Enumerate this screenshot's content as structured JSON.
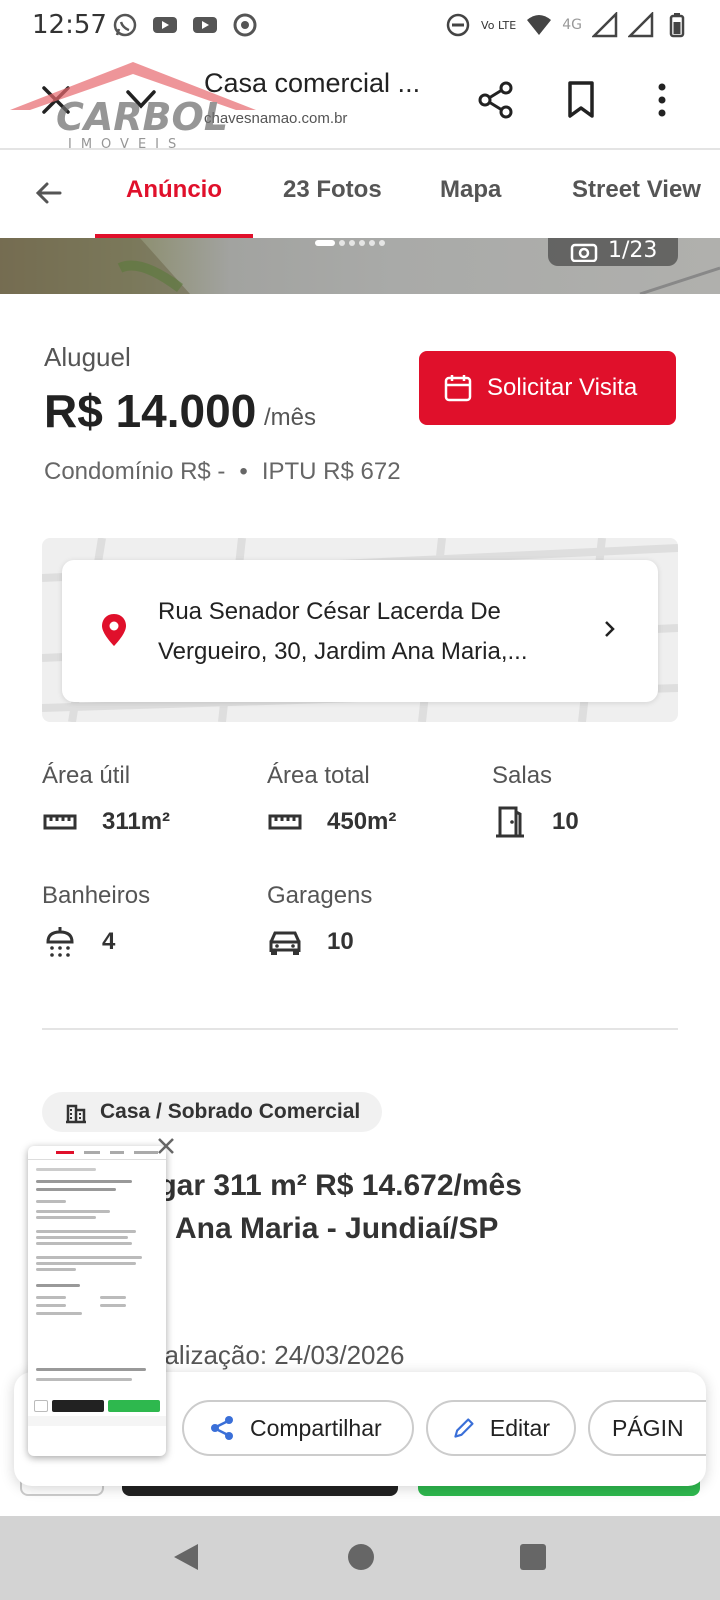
{
  "status_bar": {
    "time": "12:57",
    "network": "4G",
    "volte": "Vo LTE",
    "icons": [
      "whatsapp-icon",
      "youtube-icon",
      "youtube-icon",
      "chrome-icon",
      "dnd-icon",
      "wifi-icon",
      "signal-icon",
      "battery-icon"
    ]
  },
  "app_bar": {
    "title": "Casa comercial ...",
    "url": "chavesnamao.com.br",
    "watermark": "CARBOL IMOVEIS"
  },
  "tabs": {
    "items": [
      "Anúncio",
      "23 Fotos",
      "Mapa",
      "Street View"
    ],
    "active": "Anúncio"
  },
  "hero": {
    "photo_counter": "1/23"
  },
  "price": {
    "label": "Aluguel",
    "value": "R$ 14.000",
    "unit": "/mês",
    "condominio": "Condomínio R$ -",
    "separator": "•",
    "iptu": "IPTU R$ 672"
  },
  "visit_button": {
    "label": "Solicitar Visita"
  },
  "address": {
    "line1": "Rua Senador César Lacerda De",
    "line2": "Vergueiro, 30, Jardim Ana Maria,..."
  },
  "features": {
    "area_util": {
      "label": "Área útil",
      "value": "311m²"
    },
    "area_total": {
      "label": "Área total",
      "value": "450m²"
    },
    "salas": {
      "label": "Salas",
      "value": "10"
    },
    "banheiros": {
      "label": "Banheiros",
      "value": "4"
    },
    "garagens": {
      "label": "Garagens",
      "value": "10"
    }
  },
  "listing": {
    "type": "Casa / Sobrado Comercial",
    "title_line1": "ugar 311 m² R$ 14.672/mês",
    "title_line2": "Ana Maria - Jundiaí/SP",
    "update": "ualização: 24/03/2026"
  },
  "share_sheet": {
    "share": "Compartilhar",
    "edit": "Editar",
    "page": "PÁGIN"
  },
  "colors": {
    "brand_red": "#e0102b",
    "green": "#2eb84e"
  }
}
